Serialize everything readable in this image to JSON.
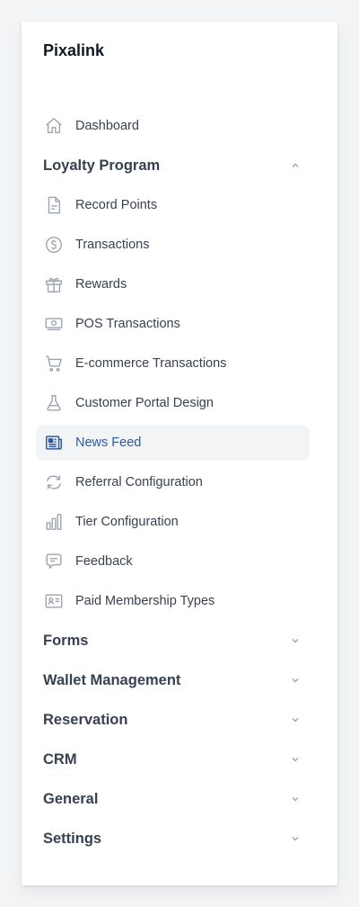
{
  "brand": "Pixalink",
  "nav": {
    "dashboard": "Dashboard",
    "loyalty": {
      "title": "Loyalty Program",
      "items": [
        {
          "label": "Record Points",
          "icon": "document-icon"
        },
        {
          "label": "Transactions",
          "icon": "dollar-circle-icon"
        },
        {
          "label": "Rewards",
          "icon": "gift-icon"
        },
        {
          "label": "POS Transactions",
          "icon": "cash-icon"
        },
        {
          "label": "E-commerce Transactions",
          "icon": "cart-icon"
        },
        {
          "label": "Customer Portal Design",
          "icon": "beaker-icon"
        },
        {
          "label": "News Feed",
          "icon": "newspaper-icon",
          "active": true
        },
        {
          "label": "Referral Configuration",
          "icon": "refresh-icon"
        },
        {
          "label": "Tier Configuration",
          "icon": "bar-chart-icon"
        },
        {
          "label": "Feedback",
          "icon": "chat-icon"
        },
        {
          "label": "Paid Membership Types",
          "icon": "id-card-icon"
        }
      ]
    },
    "sections": [
      "Forms",
      "Wallet Management",
      "Reservation",
      "CRM",
      "General",
      "Settings"
    ]
  },
  "colors": {
    "active_text": "#2c5a9e",
    "active_bg": "#f3f4f6",
    "icon_gray": "#9ca3af"
  }
}
